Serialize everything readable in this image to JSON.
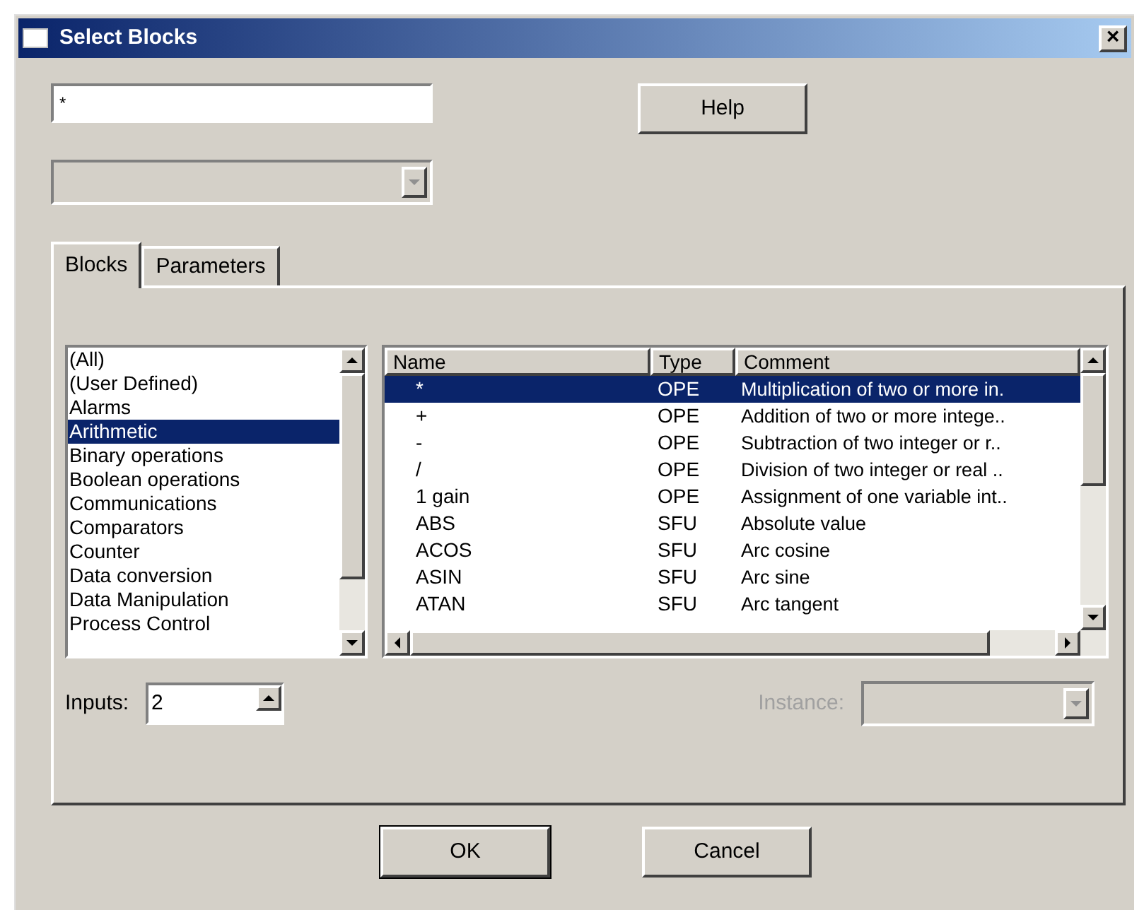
{
  "window": {
    "title": "Select Blocks",
    "close": "×"
  },
  "search": {
    "value": "*"
  },
  "help_button": "Help",
  "filter_dropdown": {
    "disabled": true
  },
  "tabs": [
    {
      "label": "Blocks",
      "selected": true
    },
    {
      "label": "Parameters",
      "selected": false
    }
  ],
  "categories": [
    {
      "label": "(All)",
      "selected": false
    },
    {
      "label": "(User Defined)",
      "selected": false
    },
    {
      "label": "Alarms",
      "selected": false
    },
    {
      "label": "Arithmetic",
      "selected": true
    },
    {
      "label": "Binary operations",
      "selected": false
    },
    {
      "label": "Boolean operations",
      "selected": false
    },
    {
      "label": "Communications",
      "selected": false
    },
    {
      "label": "Comparators",
      "selected": false
    },
    {
      "label": "Counter",
      "selected": false
    },
    {
      "label": "Data conversion",
      "selected": false
    },
    {
      "label": "Data Manipulation",
      "selected": false
    },
    {
      "label": "Process Control",
      "selected": false
    }
  ],
  "table": {
    "columns": [
      "Name",
      "Type",
      "Comment"
    ],
    "rows": [
      {
        "cells": [
          "*",
          "OPE",
          "Multiplication of two or more in."
        ],
        "selected": true
      },
      {
        "cells": [
          "+",
          "OPE",
          "Addition of two or more intege.."
        ],
        "selected": false
      },
      {
        "cells": [
          "-",
          "OPE",
          "Subtraction of two integer or r.."
        ],
        "selected": false
      },
      {
        "cells": [
          "/",
          "OPE",
          "Division of two integer or real .."
        ],
        "selected": false
      },
      {
        "cells": [
          "1 gain",
          "OPE",
          "Assignment of one variable int.."
        ],
        "selected": false
      },
      {
        "cells": [
          "ABS",
          "SFU",
          "Absolute value"
        ],
        "selected": false
      },
      {
        "cells": [
          "ACOS",
          "SFU",
          "Arc cosine"
        ],
        "selected": false
      },
      {
        "cells": [
          "ASIN",
          "SFU",
          "Arc sine"
        ],
        "selected": false
      },
      {
        "cells": [
          "ATAN",
          "SFU",
          "Arc tangent"
        ],
        "selected": false
      }
    ]
  },
  "inputs": {
    "label": "Inputs:",
    "value": "2"
  },
  "instance": {
    "label": "Instance:",
    "disabled": true
  },
  "buttons": [
    "OK",
    "Cancel"
  ]
}
